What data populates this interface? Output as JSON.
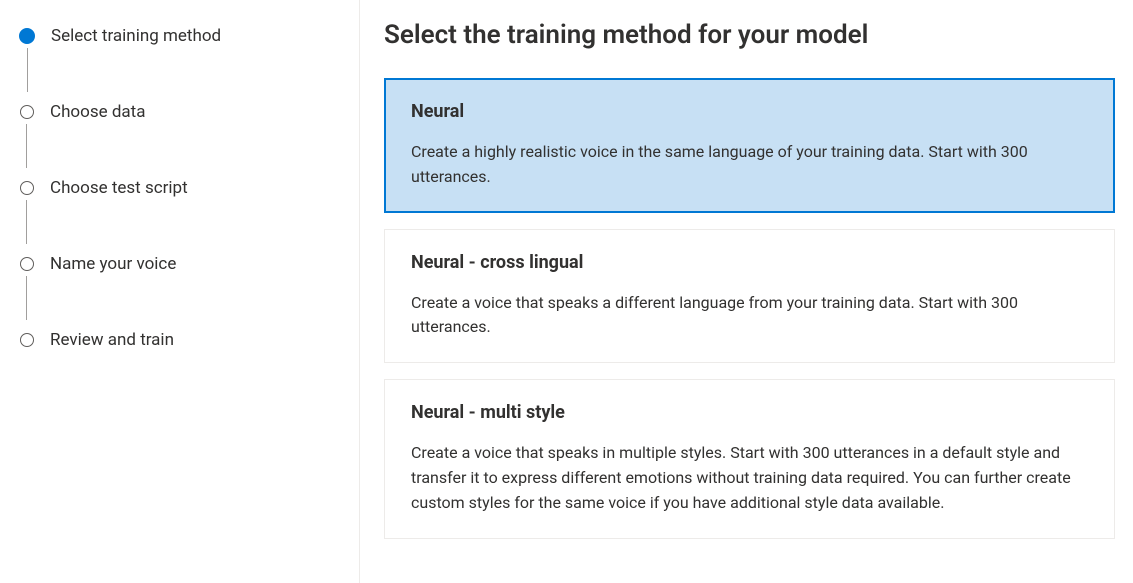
{
  "sidebar": {
    "steps": [
      {
        "label": "Select training method",
        "active": true
      },
      {
        "label": "Choose data",
        "active": false
      },
      {
        "label": "Choose test script",
        "active": false
      },
      {
        "label": "Name your voice",
        "active": false
      },
      {
        "label": "Review and train",
        "active": false
      }
    ]
  },
  "main": {
    "title": "Select the training method for your model",
    "options": [
      {
        "title": "Neural",
        "desc": "Create a highly realistic voice in the same language of your training data. Start with 300 utterances.",
        "selected": true
      },
      {
        "title": "Neural - cross lingual",
        "desc": "Create a voice that speaks a different language from your training data. Start with 300 utterances.",
        "selected": false
      },
      {
        "title": "Neural - multi style",
        "desc": "Create a voice that speaks in multiple styles. Start with 300 utterances in a default style and transfer it to express different emotions without training data required. You can further create custom styles for the same voice if you have additional style data available.",
        "selected": false
      }
    ]
  }
}
